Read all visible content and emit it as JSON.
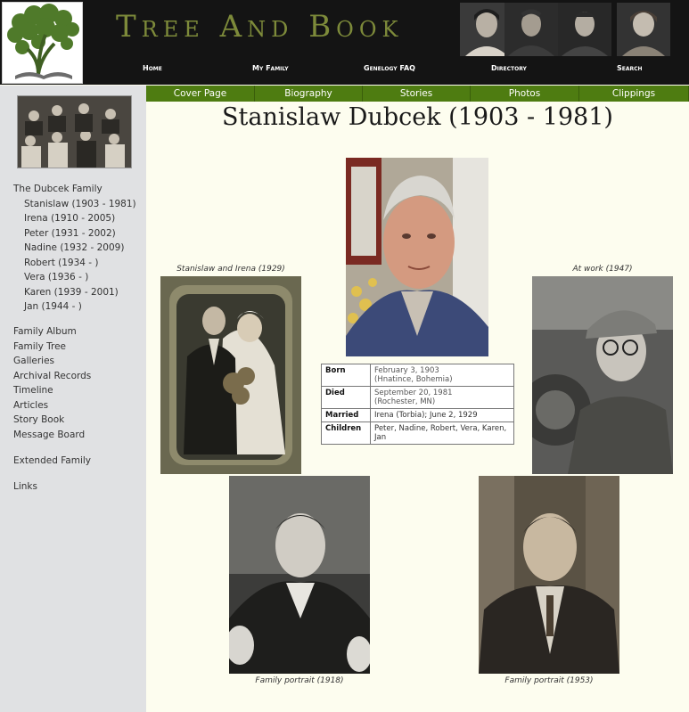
{
  "header": {
    "title": "Tree And Book",
    "nav": [
      "Home",
      "My Family",
      "Genelogy FAQ",
      "Directory",
      "Search"
    ]
  },
  "tabs": [
    "Cover Page",
    "Biography",
    "Stories",
    "Photos",
    "Clippings"
  ],
  "sidebar": {
    "family_heading": "The Dubcek Family",
    "members": [
      "Stanislaw (1903 - 1981)",
      "Irena (1910 - 2005)",
      "Peter (1931 - 2002)",
      "Nadine (1932 - 2009)",
      "Robert (1934 - )",
      "Vera (1936 - )",
      "Karen (1939 - 2001)",
      "Jan (1944 - )"
    ],
    "links": [
      "Family Album",
      "Family Tree",
      "Galleries",
      "Archival Records",
      "Timeline",
      "Articles",
      "Story Book",
      "Message Board"
    ],
    "extended": "Extended Family",
    "links_label": "Links"
  },
  "main": {
    "title": "Stanislaw Dubcek (1903 - 1981)",
    "captions": {
      "wedding": "Stanislaw and Irena (1929)",
      "work": "At work (1947)",
      "portrait_1918": "Family portrait (1918)",
      "portrait_1953": "Family portrait (1953)"
    },
    "facts": {
      "born_label": "Born",
      "born_date": "February 3, 1903",
      "born_place": "(Hnatince, Bohemia)",
      "died_label": "Died",
      "died_date": "September 20, 1981",
      "died_place": "(Rochester, MN)",
      "married_label": "Married",
      "married_value": "Irena (Torbia); June 2, 1929",
      "children_label": "Children",
      "children_value": "Peter, Nadine, Robert, Vera, Karen, Jan"
    }
  },
  "colors": {
    "header_bg": "#141414",
    "title_olive": "#7d8a3a",
    "tab_green": "#4e7c11",
    "sidebar_bg": "#e0e1e3",
    "page_bg": "#fdfdef"
  }
}
